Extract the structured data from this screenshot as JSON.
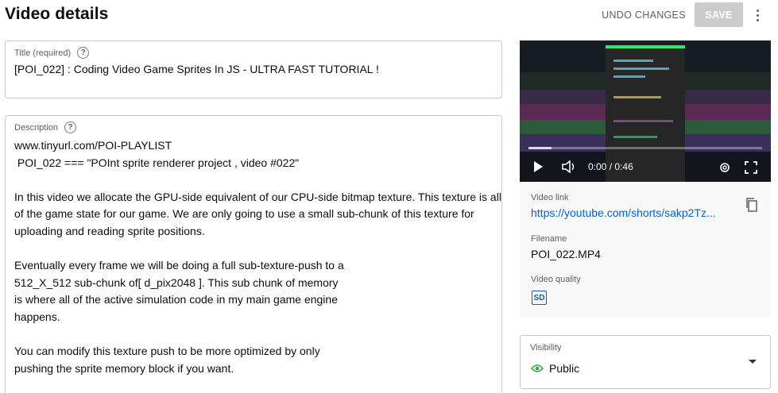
{
  "header": {
    "title": "Video details",
    "undo_label": "UNDO CHANGES",
    "save_label": "SAVE"
  },
  "title_field": {
    "label": "Title (required)",
    "value": "[POI_022] : Coding Video Game Sprites In JS - ULTRA FAST TUTORIAL !"
  },
  "description_field": {
    "label": "Description",
    "value": "www.tinyurl.com/POI-PLAYLIST\n POI_022 === \"POInt sprite renderer project , video #022\"\n\nIn this video we allocate the GPU-side equivalent of our CPU-side bitmap texture. This texture is all\nof the game state for our game. We are only going to use a small sub-chunk of this texture for\nuploading and reading sprite positions.\n\nEventually every frame we will be doing a full sub-texture-push to a\n512_X_512 sub-chunk of[ d_pix2048 ]. This sub chunk of memory\nis where all of the active simulation code in my main game engine\nhappens.\n\nYou can modify this texture push to be more optimized by only\npushing the sprite memory block if you want."
  },
  "player": {
    "time_current": "0:00",
    "time_separator": "/",
    "time_total": "0:46",
    "progress": 0.1
  },
  "video_info": {
    "link_label": "Video link",
    "link_value": "https://youtube.com/shorts/sakp2Tz...",
    "filename_label": "Filename",
    "filename_value": "POI_022.MP4",
    "quality_label": "Video quality",
    "quality_badge": "SD"
  },
  "visibility": {
    "label": "Visibility",
    "value": "Public"
  },
  "colors": {
    "link": "#065fd4",
    "save_disabled": "#cccccc",
    "eye_green": "#2ba640"
  }
}
